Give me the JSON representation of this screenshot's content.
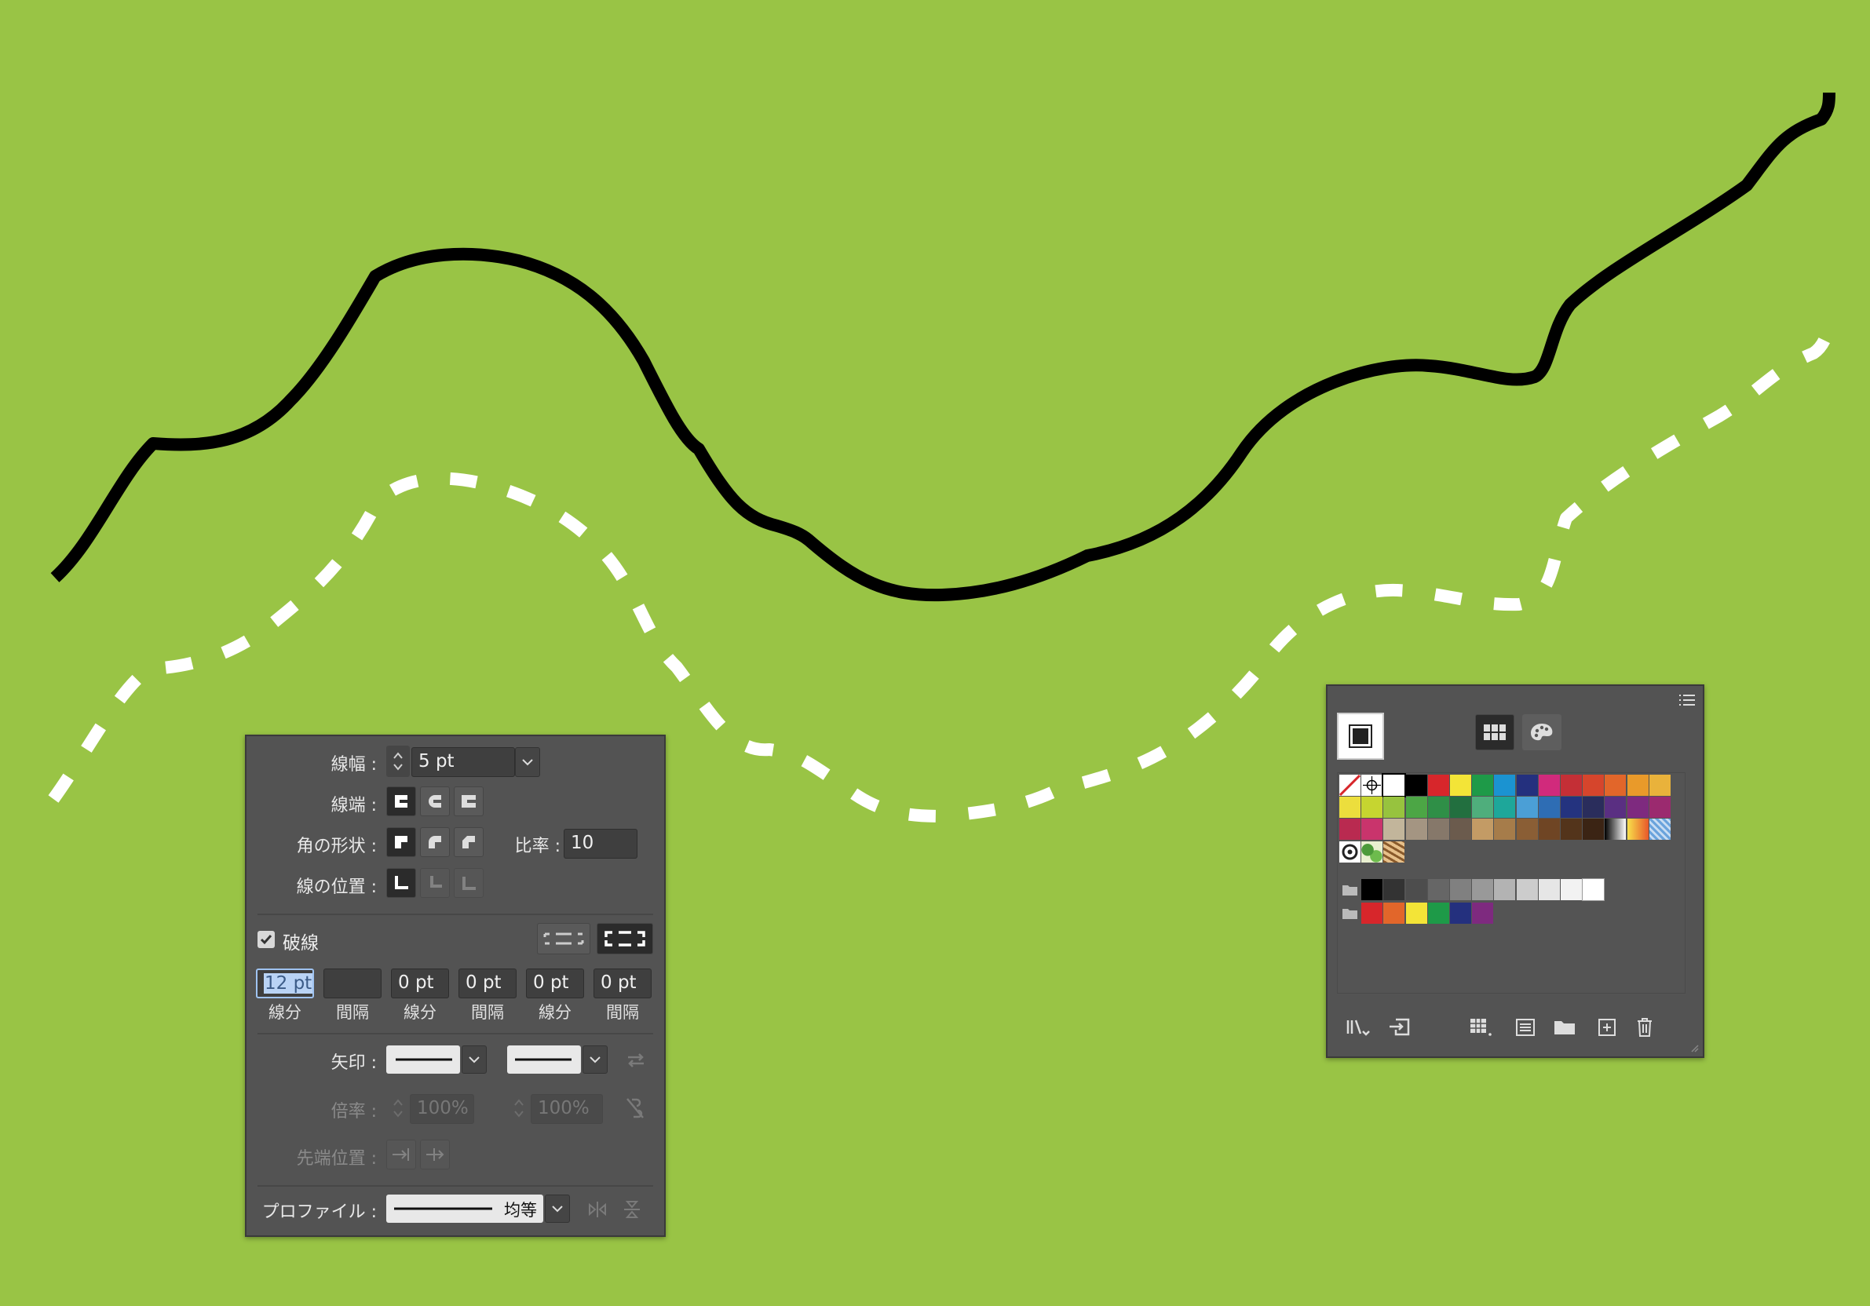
{
  "canvas": {
    "background": "#99c445"
  },
  "stroke_panel": {
    "weight": {
      "label": "線幅 :",
      "value": "5 pt"
    },
    "cap": {
      "label": "線端 :"
    },
    "corner": {
      "label": "角の形状 :",
      "ratio_label": "比率 :",
      "ratio_value": "10"
    },
    "align": {
      "label": "線の位置 :"
    },
    "dashed": {
      "label": "破線",
      "checked": true
    },
    "dash_fields": [
      {
        "value": "12 pt",
        "caption": "線分"
      },
      {
        "value": "",
        "caption": "間隔"
      },
      {
        "value": "0 pt",
        "caption": "線分"
      },
      {
        "value": "0 pt",
        "caption": "間隔"
      },
      {
        "value": "0 pt",
        "caption": "線分"
      },
      {
        "value": "0 pt",
        "caption": "間隔"
      }
    ],
    "arrow": {
      "label": "矢印 :"
    },
    "scale": {
      "label": "倍率 :",
      "start": "100%",
      "end": "100%"
    },
    "tip": {
      "label": "先端位置 :"
    },
    "profile": {
      "label": "プロファイル :",
      "value": "均等"
    }
  },
  "swatch_panel": {
    "menu_icon": "menu-icon",
    "rows": [
      [
        "none",
        "registration",
        "#ffffff",
        "#000000",
        "#d7262b",
        "#f3e437",
        "#1e9a48",
        "#1b93d1",
        "#24307e",
        "#d12a7c",
        "#c42f36",
        "#d6452c",
        "#e2662a",
        "#e99a2a",
        "#e9b23b"
      ],
      [
        "#ecde3d",
        "#c6d530",
        "#97c33e",
        "#4ca645",
        "#2f8f47",
        "#226f3f",
        "#4fae7c",
        "#1ea79a",
        "#4b9fd6",
        "#2e6db4",
        "#24337f",
        "#2a2d5c",
        "#5a2f82",
        "#7e2a7f",
        "#9b2a6f"
      ],
      [
        "#b92a50",
        "#c9346c",
        "#c2b59b",
        "#a49582",
        "#86786a",
        "#6b5b4d",
        "#c39b65",
        "#a67c4a",
        "#8a5e35",
        "#6f4524",
        "#53341b",
        "#3b2414",
        "gradient-bw",
        "gradient-orange",
        "pattern-blue"
      ],
      [
        "pattern-dots",
        "pattern-leaves",
        "pattern-tiger"
      ]
    ],
    "gray_group": [
      "#000000",
      "#333333",
      "#4d4d4d",
      "#666666",
      "#808080",
      "#999999",
      "#b3b3b3",
      "#cccccc",
      "#e6e6e6",
      "#f2f2f2",
      "#ffffff"
    ],
    "color_group": [
      "#d7262b",
      "#e2662a",
      "#f3e437",
      "#1e9a48",
      "#24307e",
      "#7e2a7f"
    ]
  }
}
